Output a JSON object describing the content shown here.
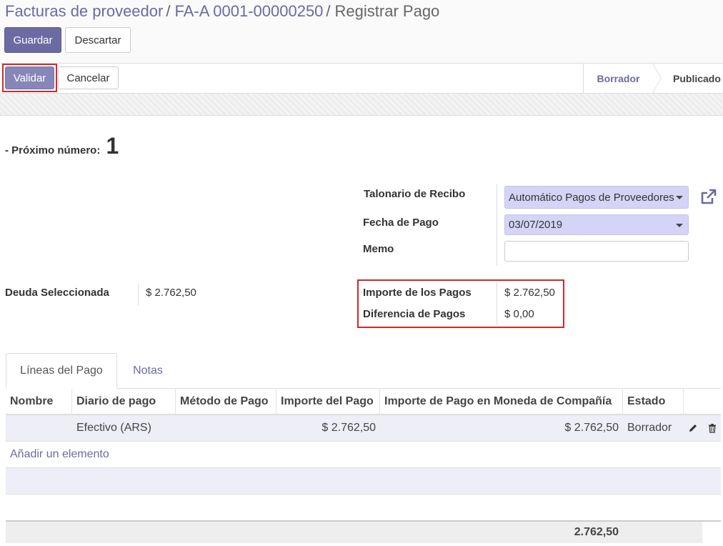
{
  "breadcrumb": {
    "items": [
      "Facturas de proveedor",
      "FA-A 0001-00000250"
    ],
    "separator": "/",
    "current": "Registrar Pago"
  },
  "buttons": {
    "save": "Guardar",
    "discard": "Descartar",
    "validate": "Validar",
    "cancel": "Cancelar"
  },
  "statusbar": {
    "stages": [
      "Borrador",
      "Publicado"
    ],
    "active": "Borrador"
  },
  "form": {
    "next_number_label": "- Próximo número:",
    "next_number_value": "1",
    "receipt_book_label": "Talonario de Recibo",
    "receipt_book_value": "Automático Pagos de Proveedores",
    "payment_date_label": "Fecha de Pago",
    "payment_date_value": "03/07/2019",
    "memo_label": "Memo",
    "memo_value": "",
    "selected_debt_label": "Deuda Seleccionada",
    "selected_debt_value": "$ 2.762,50",
    "payments_amount_label": "Importe de los Pagos",
    "payments_amount_value": "$ 2.762,50",
    "payments_diff_label": "Diferencia de Pagos",
    "payments_diff_value": "$ 0,00"
  },
  "tabs": [
    "Líneas del Pago",
    "Notas"
  ],
  "lines": {
    "columns": [
      "Nombre",
      "Diario de pago",
      "Método de Pago",
      "Importe del Pago",
      "Importe de Pago en Moneda de Compañía",
      "Estado"
    ],
    "rows": [
      {
        "name": "",
        "journal": "Efectivo (ARS)",
        "method": "",
        "amount": "$ 2.762,50",
        "company_amount": "$ 2.762,50",
        "state": "Borrador"
      }
    ],
    "add_line": "Añadir un elemento",
    "total": "2.762,50"
  },
  "colors": {
    "primary": "#6b6aa3",
    "selection": "#d5d4f6",
    "highlight": "#d12a2a"
  },
  "icons": [
    "external-link-icon",
    "edit-pencil-icon",
    "trash-icon",
    "dropdown-caret-icon"
  ]
}
